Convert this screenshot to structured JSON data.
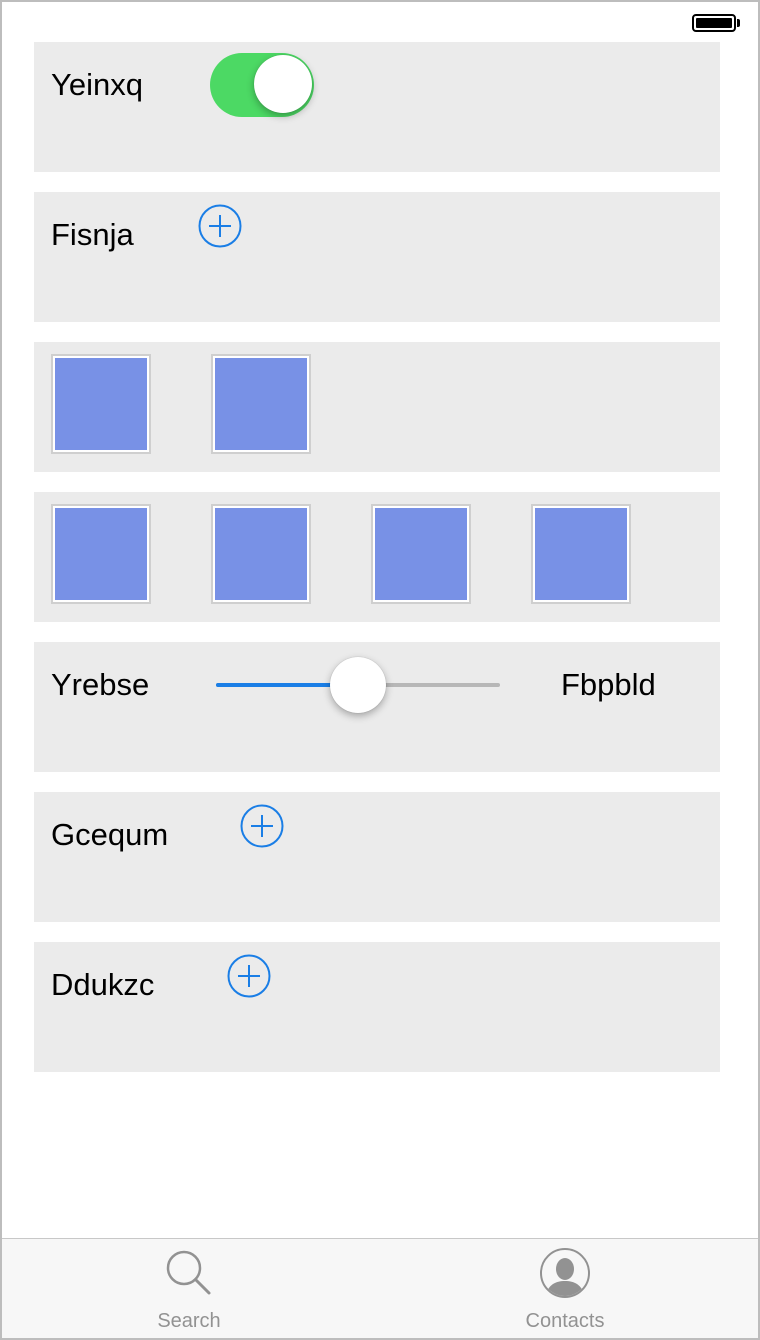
{
  "status_bar": {
    "battery_level": 1.0
  },
  "rows": {
    "toggle_row": {
      "label": "Yeinxq",
      "toggle_on": true
    },
    "fisnja": {
      "label": "Fisnja"
    },
    "swatches_two": {
      "count": 2
    },
    "swatches_four": {
      "count": 4
    },
    "slider_row": {
      "label": "Yrebse",
      "max_label": "Fbpbld",
      "value": 0.5
    },
    "gcequm": {
      "label": "Gcequm"
    },
    "ddukzc": {
      "label": "Ddukzc"
    }
  },
  "icons": {
    "add": "add-circle-icon",
    "search": "search-icon",
    "contacts": "contacts-icon"
  },
  "colors": {
    "toggle_on": "#4cd964",
    "accent": "#1a7ee6",
    "swatch": "#7891e6",
    "row_background": "#ebebeb"
  },
  "tabbar": {
    "items": [
      {
        "label": "Search",
        "icon": "search-icon"
      },
      {
        "label": "Contacts",
        "icon": "contacts-icon"
      }
    ]
  }
}
